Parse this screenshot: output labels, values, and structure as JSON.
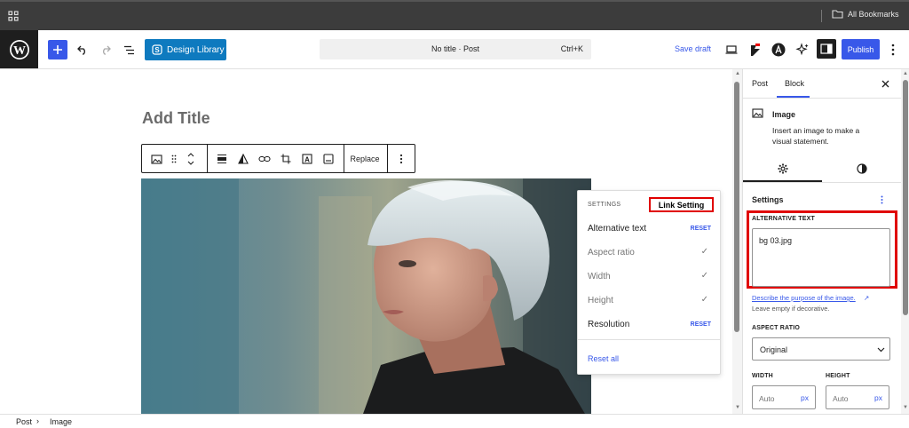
{
  "browser": {
    "bookmarks_label": "All Bookmarks"
  },
  "topbar": {
    "design_library_label": "Design Library",
    "command_title": "No title · Post",
    "command_shortcut": "Ctrl+K",
    "save_draft_label": "Save draft",
    "publish_label": "Publish"
  },
  "editor": {
    "title_placeholder": "Add Title",
    "replace_label": "Replace"
  },
  "settings_menu": {
    "heading": "SETTINGS",
    "callout": "Link Setting",
    "items": [
      {
        "label": "Alternative text",
        "action": "RESET"
      },
      {
        "label": "Aspect ratio",
        "action": "✓"
      },
      {
        "label": "Width",
        "action": "✓"
      },
      {
        "label": "Height",
        "action": "✓"
      },
      {
        "label": "Resolution",
        "action": "RESET"
      }
    ],
    "reset_all": "Reset all"
  },
  "sidebar": {
    "tabs": [
      "Post",
      "Block"
    ],
    "active_tab": "Block",
    "block_name": "Image",
    "block_description": "Insert an image to make a visual statement.",
    "panel_title": "Settings",
    "alt_text_label": "ALTERNATIVE TEXT",
    "alt_text_value": "bg 03.jpg",
    "alt_help_link": "Describe the purpose of the image.",
    "alt_help_note": "Leave empty if decorative.",
    "aspect_label": "ASPECT RATIO",
    "aspect_value": "Original",
    "width_label": "WIDTH",
    "height_label": "HEIGHT",
    "width_placeholder": "Auto",
    "height_placeholder": "Auto",
    "unit": "px"
  },
  "breadcrumb": {
    "items": [
      "Post",
      "Image"
    ]
  },
  "colors": {
    "accent": "#3858e9",
    "wp_blue": "#007cba",
    "highlight": "#e00000"
  }
}
